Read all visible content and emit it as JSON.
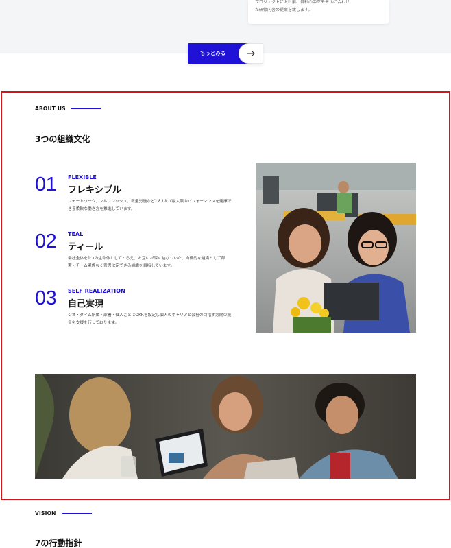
{
  "top": {
    "card_lines": [
      "プロジェクトに入社前、各社の中立モデルに合わせ",
      "た研修内容の提案を致します。"
    ],
    "more_button": {
      "label": "もっとみる",
      "arrow_icon": "arrow-right-icon"
    }
  },
  "about": {
    "eyebrow": "ABOUT US",
    "title": "3つの組織文化",
    "items": [
      {
        "num": "01",
        "en": "FLEXIBLE",
        "jp": "フレキシブル",
        "desc": "リモートワーク、フルフレックス、裁量労働など1人1人が最大限のパフォーマンスを発揮できる柔軟な働き方を推進しています。"
      },
      {
        "num": "02",
        "en": "TEAL",
        "jp": "ティール",
        "desc": "会社全体を1つの生命体としてとらえ、お互いが深く結びついた、自律的な組織として部署・チーム関係なく意思決定できる組織を目指しています。"
      },
      {
        "num": "03",
        "en": "SELF REALIZATION",
        "jp": "自己実現",
        "desc": "ジオ・ダイム所属・部署・個人ごとにOKRを設定し個人のキャリアと会社の目指す方向の統合を支援を行っております。"
      }
    ],
    "accent": "#1f12d6",
    "border": "#d4141a"
  },
  "vision": {
    "eyebrow": "VISION",
    "title": "7の行動指針"
  }
}
